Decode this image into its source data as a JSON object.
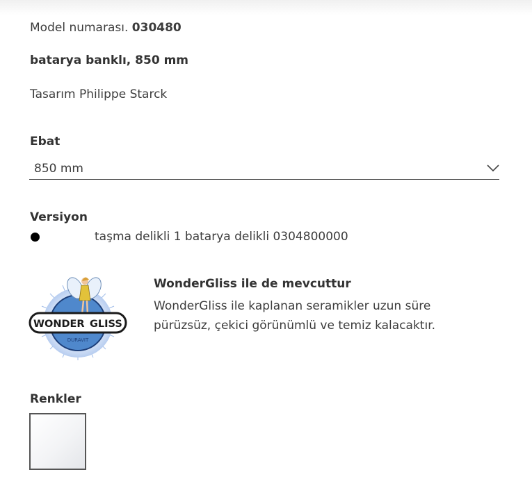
{
  "product": {
    "model_label": "Model numarası.",
    "model_number": "030480",
    "subtitle": "batarya banklı, 850 mm",
    "designer": "Tasarım Philippe Starck"
  },
  "size": {
    "label": "Ebat",
    "selected": "850 mm",
    "icon": "chevron-down-icon"
  },
  "version": {
    "label": "Versiyon",
    "selected_text": "taşma delikli 1 batarya delikli 0304800000"
  },
  "wondergliss": {
    "logo_wonder": "WONDER",
    "logo_gliss": "GLISS",
    "logo_brand": "DURAVIT",
    "title": "WonderGliss ile de mevcuttur",
    "description": "WonderGliss ile kaplanan seramikler uzun süre pürüzsüz, çekici görünümlü ve temiz kalacaktır."
  },
  "colors": {
    "label": "Renkler",
    "swatches": [
      {
        "color": "#ffffff",
        "selected": true
      }
    ]
  }
}
